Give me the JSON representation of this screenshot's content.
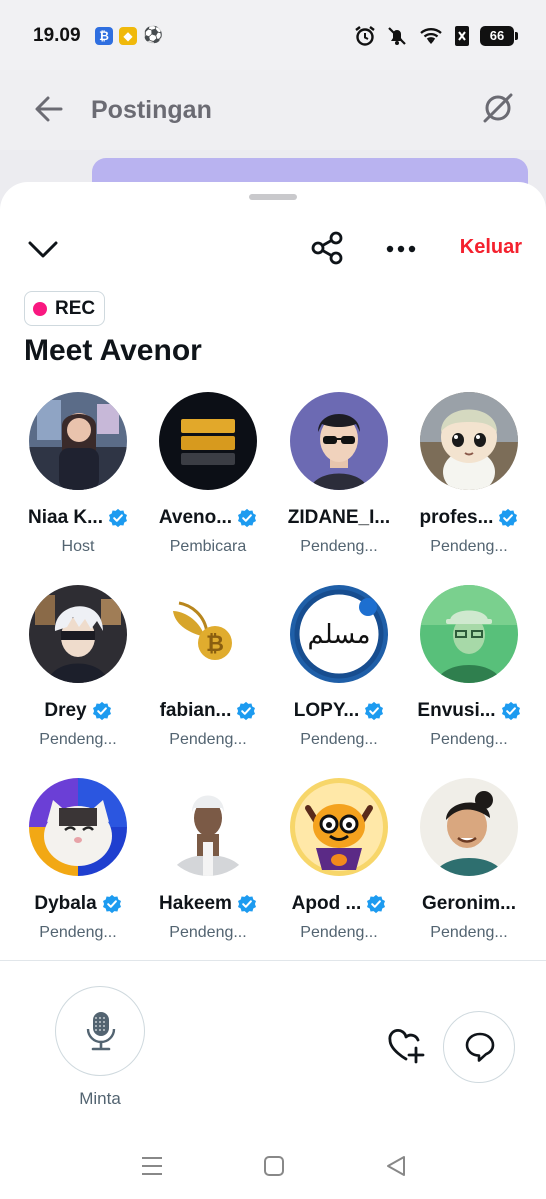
{
  "status_bar": {
    "time": "19.09",
    "battery": "66",
    "app_icons": [
      "bitcoin-app-icon",
      "binance-app-icon",
      "football-app-icon"
    ],
    "system_icons": [
      "alarm-icon",
      "mute-icon",
      "wifi-icon",
      "no-sim-icon"
    ]
  },
  "header": {
    "title": "Postingan"
  },
  "sheet": {
    "leave_label": "Keluar",
    "rec_label": "REC",
    "space_title": "Meet Avenor"
  },
  "participants": [
    {
      "name": "Niaa K...",
      "role": "Host",
      "verified": true
    },
    {
      "name": "Aveno...",
      "role": "Pembicara",
      "verified": true
    },
    {
      "name": "ZIDANE_I...",
      "role": "Pendeng...",
      "verified": false
    },
    {
      "name": "profes...",
      "role": "Pendeng...",
      "verified": true
    },
    {
      "name": "Drey",
      "role": "Pendeng...",
      "verified": true
    },
    {
      "name": "fabian...",
      "role": "Pendeng...",
      "verified": true
    },
    {
      "name": "LOPY...",
      "role": "Pendeng...",
      "verified": true
    },
    {
      "name": "Envusi...",
      "role": "Pendeng...",
      "verified": true
    },
    {
      "name": "Dybala",
      "role": "Pendeng...",
      "verified": true
    },
    {
      "name": "Hakeem",
      "role": "Pendeng...",
      "verified": true
    },
    {
      "name": "Apod ...",
      "role": "Pendeng...",
      "verified": true
    },
    {
      "name": "Geronim...",
      "role": "Pendeng...",
      "verified": false
    }
  ],
  "controls": {
    "mic_label": "Minta"
  },
  "colors": {
    "accent_red": "#f4212e",
    "rec_pink": "#f91880",
    "verified_blue": "#1d9bf0",
    "secondary_text": "#536471"
  }
}
